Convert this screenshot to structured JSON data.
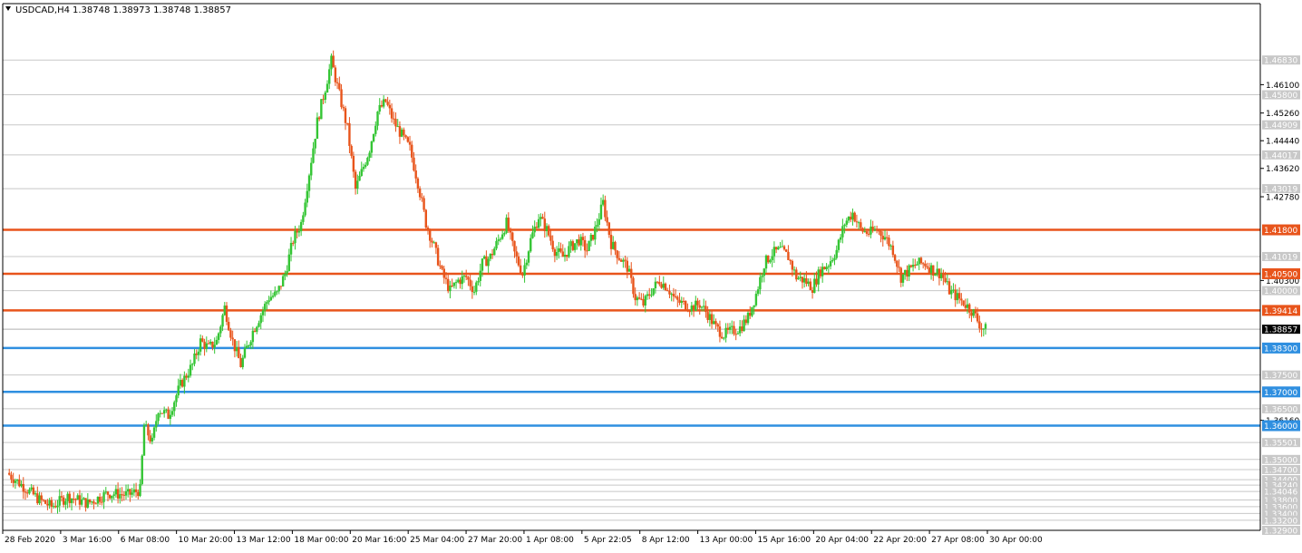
{
  "header": {
    "symbol_timeframe": "USDCAD,H4",
    "ohlc": "1.38748 1.38973 1.38748 1.38857"
  },
  "colors": {
    "background": "#ffffff",
    "axis": "#000000",
    "grid": "#c8c8c8",
    "bull": "#34c534",
    "bear": "#e8541b",
    "resistance": "#e8541b",
    "support": "#2f8fe0",
    "label_bg": "#c8c8c8",
    "label_text": "#ffffff",
    "price_tag_bg": "#000000"
  },
  "chart_data": {
    "type": "candlestick",
    "title": "USDCAD,H4",
    "ylim": [
      1.329,
      1.485
    ],
    "y_tick_labels": [
      "1.46100",
      "1.45260",
      "1.44440",
      "1.43620",
      "1.42780",
      "1.40300",
      "1.36160"
    ],
    "grid_levels": [
      1.4683,
      1.458,
      1.4491,
      1.4402,
      1.4302,
      1.4101,
      1.4,
      1.375,
      1.365,
      1.355,
      1.35,
      1.347,
      1.344,
      1.3424,
      1.3405,
      1.338,
      1.336,
      1.334,
      1.332,
      1.329
    ],
    "grid_labels": [
      "1.46830",
      "1.45800",
      "1.44909",
      "1.44017",
      "1.43019",
      "1.41019",
      "1.40000",
      "1.37500",
      "1.36500",
      "1.35501",
      "1.35000",
      "1.34700",
      "1.34400",
      "1.34240",
      "1.34046",
      "1.33800",
      "1.33600",
      "1.33400",
      "1.33200",
      "1.32900"
    ],
    "x_labels": [
      "28 Feb 2020",
      "3 Mar 16:00",
      "6 Mar 08:00",
      "10 Mar 20:00",
      "13 Mar 12:00",
      "18 Mar 00:00",
      "20 Mar 16:00",
      "25 Mar 04:00",
      "27 Mar 20:00",
      "1 Apr 08:00",
      "5 Apr 22:05",
      "8 Apr 12:00",
      "13 Apr 00:00",
      "15 Apr 16:00",
      "20 Apr 04:00",
      "22 Apr 20:00",
      "27 Apr 08:00",
      "30 Apr 00:00"
    ],
    "current_price": 1.38857,
    "current_price_label": "1.38857",
    "levels": [
      {
        "price": 1.418,
        "label": "1.41800",
        "kind": "resistance"
      },
      {
        "price": 1.405,
        "label": "1.40500",
        "kind": "resistance"
      },
      {
        "price": 1.39414,
        "label": "1.39414",
        "kind": "resistance"
      },
      {
        "price": 1.383,
        "label": "1.38300",
        "kind": "support"
      },
      {
        "price": 1.37,
        "label": "1.37000",
        "kind": "support"
      },
      {
        "price": 1.36,
        "label": "1.36000",
        "kind": "support"
      }
    ],
    "close_path": [
      [
        0,
        1.346
      ],
      [
        8,
        1.342
      ],
      [
        16,
        1.338
      ],
      [
        22,
        1.336
      ],
      [
        30,
        1.339
      ],
      [
        40,
        1.337
      ],
      [
        50,
        1.34
      ],
      [
        60,
        1.3395
      ],
      [
        66,
        1.341
      ],
      [
        68,
        1.36
      ],
      [
        72,
        1.355
      ],
      [
        75,
        1.365
      ],
      [
        80,
        1.363
      ],
      [
        86,
        1.372
      ],
      [
        92,
        1.378
      ],
      [
        96,
        1.385
      ],
      [
        100,
        1.383
      ],
      [
        104,
        1.385
      ],
      [
        108,
        1.395
      ],
      [
        112,
        1.385
      ],
      [
        116,
        1.378
      ],
      [
        122,
        1.388
      ],
      [
        126,
        1.393
      ],
      [
        130,
        1.398
      ],
      [
        134,
        1.399
      ],
      [
        138,
        1.405
      ],
      [
        142,
        1.415
      ],
      [
        146,
        1.42
      ],
      [
        150,
        1.435
      ],
      [
        154,
        1.45
      ],
      [
        158,
        1.46
      ],
      [
        161,
        1.468
      ],
      [
        165,
        1.458
      ],
      [
        169,
        1.448
      ],
      [
        173,
        1.43
      ],
      [
        176,
        1.435
      ],
      [
        180,
        1.442
      ],
      [
        184,
        1.453
      ],
      [
        188,
        1.456
      ],
      [
        192,
        1.45
      ],
      [
        196,
        1.446
      ],
      [
        200,
        1.442
      ],
      [
        204,
        1.432
      ],
      [
        208,
        1.42
      ],
      [
        212,
        1.413
      ],
      [
        216,
        1.405
      ],
      [
        220,
        1.4
      ],
      [
        224,
        1.403
      ],
      [
        228,
        1.404
      ],
      [
        232,
        1.4
      ],
      [
        236,
        1.408
      ],
      [
        240,
        1.41
      ],
      [
        244,
        1.415
      ],
      [
        248,
        1.42
      ],
      [
        252,
        1.411
      ],
      [
        256,
        1.405
      ],
      [
        260,
        1.415
      ],
      [
        264,
        1.422
      ],
      [
        268,
        1.418
      ],
      [
        272,
        1.412
      ],
      [
        276,
        1.41
      ],
      [
        280,
        1.413
      ],
      [
        284,
        1.415
      ],
      [
        288,
        1.412
      ],
      [
        292,
        1.418
      ],
      [
        296,
        1.426
      ],
      [
        300,
        1.414
      ],
      [
        304,
        1.41
      ],
      [
        308,
        1.407
      ],
      [
        312,
        1.398
      ],
      [
        316,
        1.396
      ],
      [
        320,
        1.4
      ],
      [
        324,
        1.403
      ],
      [
        328,
        1.401
      ],
      [
        332,
        1.397
      ],
      [
        336,
        1.396
      ],
      [
        340,
        1.395
      ],
      [
        344,
        1.396
      ],
      [
        348,
        1.393
      ],
      [
        352,
        1.389
      ],
      [
        356,
        1.387
      ],
      [
        360,
        1.388
      ],
      [
        364,
        1.389
      ],
      [
        368,
        1.392
      ],
      [
        372,
        1.399
      ],
      [
        376,
        1.408
      ],
      [
        380,
        1.411
      ],
      [
        384,
        1.412
      ],
      [
        388,
        1.41
      ],
      [
        392,
        1.404
      ],
      [
        396,
        1.403
      ],
      [
        400,
        1.401
      ],
      [
        404,
        1.406
      ],
      [
        408,
        1.408
      ],
      [
        412,
        1.412
      ],
      [
        416,
        1.42
      ],
      [
        420,
        1.423
      ],
      [
        424,
        1.418
      ],
      [
        428,
        1.417
      ],
      [
        432,
        1.418
      ],
      [
        436,
        1.416
      ],
      [
        440,
        1.412
      ],
      [
        444,
        1.404
      ],
      [
        448,
        1.406
      ],
      [
        452,
        1.408
      ],
      [
        456,
        1.408
      ],
      [
        460,
        1.406
      ],
      [
        464,
        1.405
      ],
      [
        468,
        1.4
      ],
      [
        472,
        1.398
      ],
      [
        476,
        1.396
      ],
      [
        480,
        1.3935
      ],
      [
        484,
        1.389
      ],
      [
        486,
        1.38857
      ]
    ]
  }
}
